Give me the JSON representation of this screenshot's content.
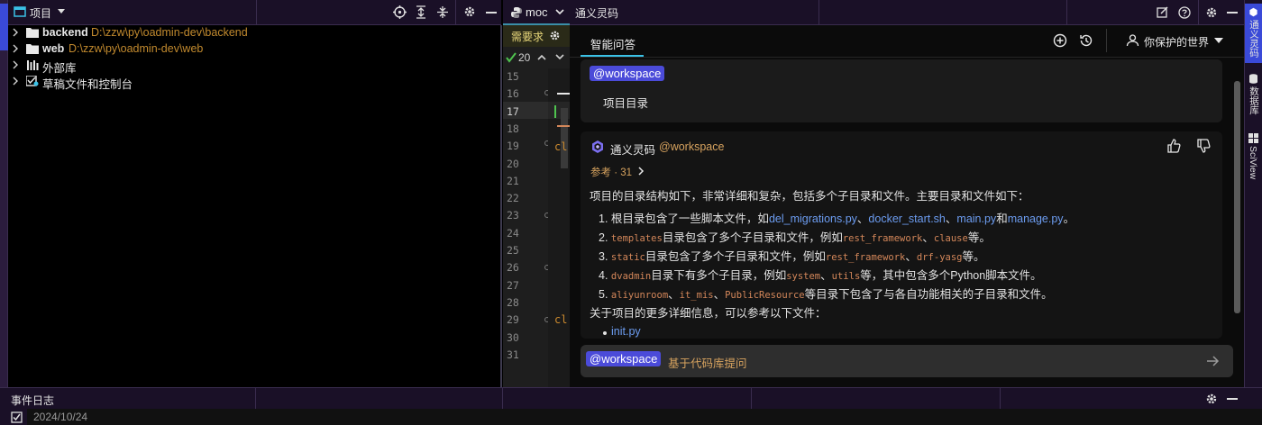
{
  "project_panel": {
    "title": "项目",
    "tree": [
      {
        "name": "backend",
        "path": "D:\\zzw\\py\\oadmin-dev\\backend"
      },
      {
        "name": "web",
        "path": "D:\\zzw\\py\\oadmin-dev\\web"
      },
      {
        "name": "外部库",
        "path": ""
      },
      {
        "name": "草稿文件和控制台",
        "path": ""
      }
    ]
  },
  "editor": {
    "tab_label": "moc",
    "toolbar_label": "需要求",
    "inspection_count": "20",
    "line_numbers": [
      "15",
      "16",
      "17",
      "18",
      "19",
      "20",
      "21",
      "22",
      "23",
      "24",
      "25",
      "26",
      "27",
      "28",
      "29",
      "30",
      "31"
    ],
    "current_line": "17",
    "code_fragments": {
      "line19": "cl",
      "line29": "cl"
    }
  },
  "ai_panel": {
    "window_title": "通义灵码",
    "tab_label": "智能问答",
    "user_name": "你保护的世界",
    "user_message": {
      "mention": "@workspace",
      "text": "项目目录"
    },
    "answer": {
      "assistant_name": "通义灵码",
      "mention": "@workspace",
      "reference": "参考 · 31",
      "intro": "项目的目录结构如下，非常详细和复杂，包括多个子目录和文件。主要目录和文件如下：",
      "items": [
        {
          "num": "1.",
          "pre": "根目录包含了一些脚本文件，如",
          "l1": "del_migrations.py",
          "s1": "、",
          "l2": "docker_start.sh",
          "s2": "、",
          "l3": "main.py",
          "s3": "和",
          "l4": "manage.py",
          "post": "。"
        },
        {
          "num": "2.",
          "code1": "templates",
          "mid": "目录包含了多个子目录和文件，例如",
          "code2": "rest_framework",
          "sep": "、",
          "code3": "clause",
          "post": "等。"
        },
        {
          "num": "3.",
          "code1": "static",
          "mid": "目录包含了多个子目录和文件，例如",
          "code2": "rest_framework",
          "sep": "、",
          "code3": "drf-yasg",
          "post": "等。"
        },
        {
          "num": "4.",
          "code1": "dvadmin",
          "mid": "目录下有多个子目录，例如",
          "code2": "system",
          "sep": "、",
          "code3": "utils",
          "post": "等，其中包含多个Python脚本文件。"
        },
        {
          "num": "5.",
          "code1": "aliyunroom",
          "sep1": "、",
          "code2": "it_mis",
          "sep2": "、",
          "code3": "PublicResource",
          "post": "等目录下包含了与各自功能相关的子目录和文件。"
        }
      ],
      "outro": "关于项目的更多详细信息，可以参考以下文件：",
      "bullet_partial": "init.py"
    },
    "input": {
      "mention": "@workspace",
      "placeholder": "基于代码库提问"
    }
  },
  "right_strip": {
    "tabs": [
      "通义灵码",
      "数据库",
      "SciView"
    ]
  },
  "bottom_panel": {
    "title": "事件日志",
    "date": "2024/10/24"
  },
  "colors": {
    "accent_blue": "#4b4bd9",
    "path_orange": "#c28a2e",
    "link_blue": "#6c9cf0",
    "chrome_purple": "#1a1027"
  }
}
